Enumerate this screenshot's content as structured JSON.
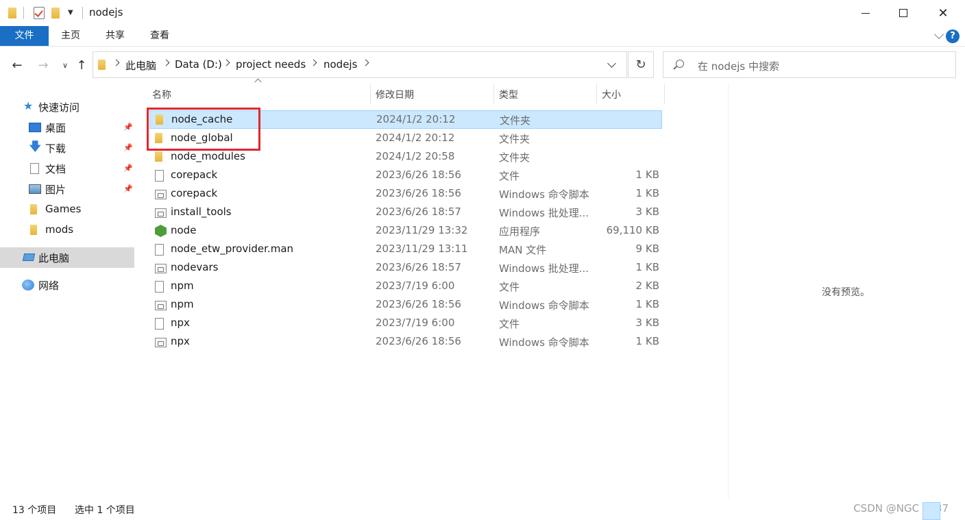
{
  "window": {
    "title": "nodejs"
  },
  "ribbon": {
    "tabs": [
      "文件",
      "主页",
      "共享",
      "查看"
    ]
  },
  "address": {
    "crumbs": [
      "此电脑",
      "Data (D:)",
      "project needs",
      "nodejs"
    ]
  },
  "search": {
    "placeholder": "在 nodejs 中搜索"
  },
  "sidebar": {
    "items": [
      {
        "label": "快速访问",
        "icon": "star-icon"
      },
      {
        "label": "桌面",
        "icon": "desktop-icon",
        "pinned": true
      },
      {
        "label": "下载",
        "icon": "download-icon",
        "pinned": true
      },
      {
        "label": "文档",
        "icon": "document-icon",
        "pinned": true
      },
      {
        "label": "图片",
        "icon": "picture-icon",
        "pinned": true
      },
      {
        "label": "Games",
        "icon": "folder-icon"
      },
      {
        "label": "mods",
        "icon": "folder-icon"
      },
      {
        "label": "此电脑",
        "icon": "computer-icon",
        "selected": true
      },
      {
        "label": "网络",
        "icon": "network-icon"
      }
    ]
  },
  "columns": {
    "name": "名称",
    "date": "修改日期",
    "type": "类型",
    "size": "大小"
  },
  "files": [
    {
      "name": "node_cache",
      "date": "2024/1/2 20:12",
      "type": "文件夹",
      "size": "",
      "icon": "folder-icon",
      "selected": true
    },
    {
      "name": "node_global",
      "date": "2024/1/2 20:12",
      "type": "文件夹",
      "size": "",
      "icon": "folder-icon"
    },
    {
      "name": "node_modules",
      "date": "2024/1/2 20:58",
      "type": "文件夹",
      "size": "",
      "icon": "folder-icon"
    },
    {
      "name": "corepack",
      "date": "2023/6/26 18:56",
      "type": "文件",
      "size": "1 KB",
      "icon": "file-icon"
    },
    {
      "name": "corepack",
      "date": "2023/6/26 18:56",
      "type": "Windows 命令脚本",
      "size": "1 KB",
      "icon": "script-icon"
    },
    {
      "name": "install_tools",
      "date": "2023/6/26 18:57",
      "type": "Windows 批处理...",
      "size": "3 KB",
      "icon": "script-icon"
    },
    {
      "name": "node",
      "date": "2023/11/29 13:32",
      "type": "应用程序",
      "size": "69,110 KB",
      "icon": "node-app-icon"
    },
    {
      "name": "node_etw_provider.man",
      "date": "2023/11/29 13:11",
      "type": "MAN 文件",
      "size": "9 KB",
      "icon": "file-icon"
    },
    {
      "name": "nodevars",
      "date": "2023/6/26 18:57",
      "type": "Windows 批处理...",
      "size": "1 KB",
      "icon": "script-icon"
    },
    {
      "name": "npm",
      "date": "2023/7/19 6:00",
      "type": "文件",
      "size": "2 KB",
      "icon": "file-icon"
    },
    {
      "name": "npm",
      "date": "2023/6/26 18:56",
      "type": "Windows 命令脚本",
      "size": "1 KB",
      "icon": "script-icon"
    },
    {
      "name": "npx",
      "date": "2023/7/19 6:00",
      "type": "文件",
      "size": "3 KB",
      "icon": "file-icon"
    },
    {
      "name": "npx",
      "date": "2023/6/26 18:56",
      "type": "Windows 命令脚本",
      "size": "1 KB",
      "icon": "script-icon"
    }
  ],
  "preview": {
    "empty_text": "没有预览。"
  },
  "status": {
    "count": "13 个项目",
    "selected": "选中 1 个项目"
  },
  "watermark": "CSDN @NGC 2237",
  "colors": {
    "accent": "#1a6fc4",
    "selection": "#cce8ff",
    "highlight": "#e3262e"
  }
}
